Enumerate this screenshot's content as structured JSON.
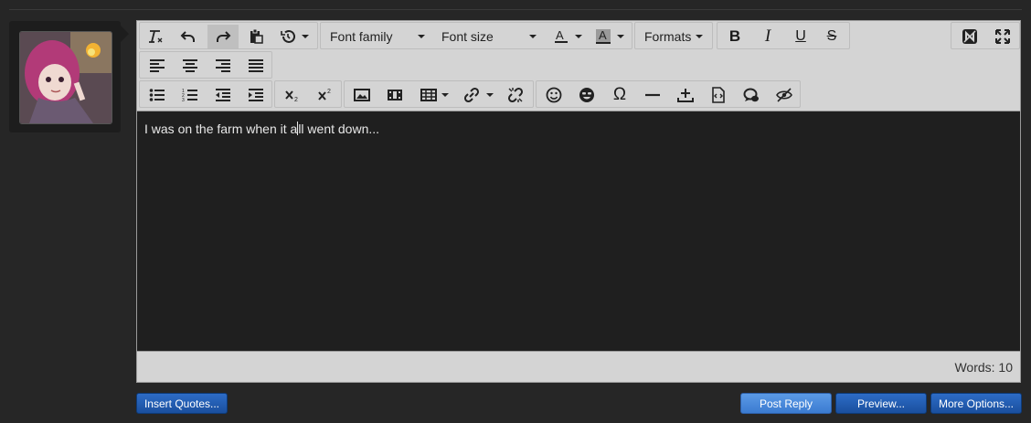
{
  "toolbar": {
    "font_family": "Font family",
    "font_size": "Font size",
    "formats": "Formats"
  },
  "editor": {
    "content_before_cursor": "I was on the farm when it a",
    "content_after_cursor": "ll went down...",
    "word_count": "Words: 10"
  },
  "actions": {
    "insert_quotes": "Insert Quotes...",
    "post_reply": "Post Reply",
    "preview": "Preview...",
    "more_options": "More Options..."
  },
  "colors": {
    "page_bg": "#262626",
    "editor_bg": "#1f1f1f",
    "toolbar_bg": "#d4d4d4",
    "button_blue": "#1a4f9e"
  },
  "icons": [
    "clear-formatting-icon",
    "undo-icon",
    "redo-icon",
    "paste-icon",
    "history-icon",
    "text-color-icon",
    "background-color-icon",
    "bold-icon",
    "italic-icon",
    "underline-icon",
    "strikethrough-icon",
    "toggle-bbcode-icon",
    "fullscreen-icon",
    "align-left-icon",
    "align-center-icon",
    "align-right-icon",
    "justify-icon",
    "bullet-list-icon",
    "numbered-list-icon",
    "outdent-icon",
    "indent-icon",
    "subscript-icon",
    "superscript-icon",
    "image-icon",
    "media-icon",
    "table-icon",
    "link-icon",
    "unlink-icon",
    "smilie-icon",
    "emoji-icon",
    "special-char-icon",
    "horizontal-rule-icon",
    "insert-icon",
    "code-icon",
    "quote-icon",
    "spoiler-icon"
  ]
}
